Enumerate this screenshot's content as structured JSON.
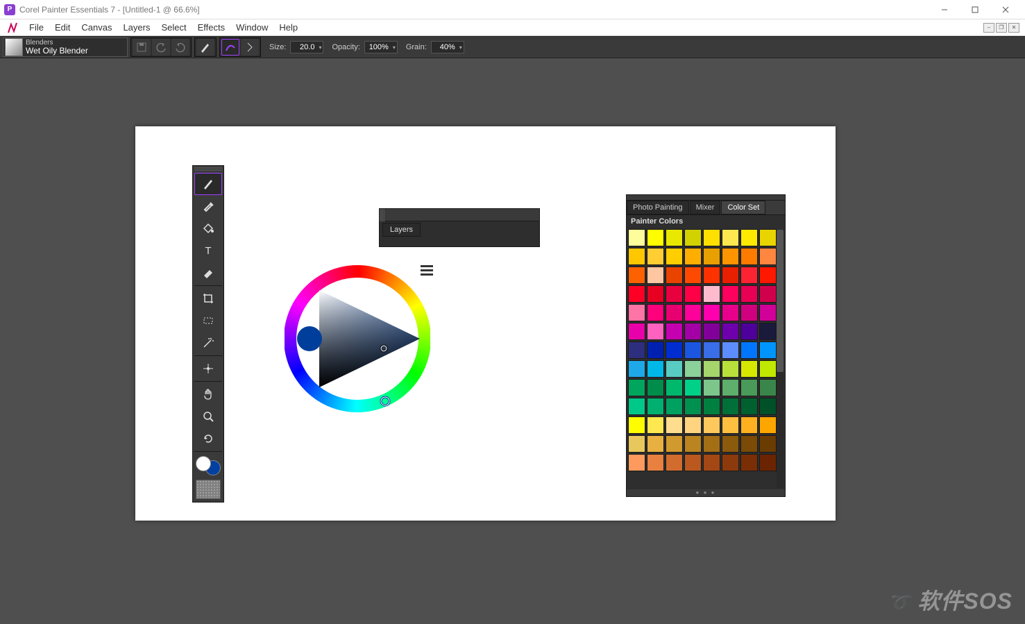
{
  "titlebar": {
    "title": "Corel Painter Essentials 7 - [Untitled-1 @ 66.6%]"
  },
  "menu": {
    "items": [
      "File",
      "Edit",
      "Canvas",
      "Layers",
      "Select",
      "Effects",
      "Window",
      "Help"
    ]
  },
  "propbar": {
    "brush_category": "Blenders",
    "brush_name": "Wet Oily Blender",
    "size_label": "Size:",
    "size_value": "20.0",
    "opacity_label": "Opacity:",
    "opacity_value": "100%",
    "grain_label": "Grain:",
    "grain_value": "40%"
  },
  "toolbox": {
    "tools": [
      {
        "name": "brush-tool",
        "icon": "brush",
        "active": true
      },
      {
        "name": "dropper-tool",
        "icon": "dropper"
      },
      {
        "name": "paint-bucket-tool",
        "icon": "bucket"
      },
      {
        "name": "text-tool",
        "icon": "text"
      },
      {
        "name": "eraser-tool",
        "icon": "eraser"
      },
      {
        "sep": true
      },
      {
        "name": "crop-tool",
        "icon": "crop"
      },
      {
        "name": "selection-tool",
        "icon": "select"
      },
      {
        "name": "magic-wand-tool",
        "icon": "wand"
      },
      {
        "sep": true
      },
      {
        "name": "transform-tool",
        "icon": "transform"
      },
      {
        "sep": true
      },
      {
        "name": "grabber-tool",
        "icon": "hand"
      },
      {
        "name": "magnifier-tool",
        "icon": "zoom"
      },
      {
        "name": "rotate-tool",
        "icon": "rotate"
      }
    ],
    "main_color": "#ffffff",
    "second_color": "#003e9c"
  },
  "layers_panel": {
    "title": "Layers"
  },
  "colorset_panel": {
    "tabs": [
      "Photo Painting",
      "Mixer",
      "Color Set"
    ],
    "active_tab": 2,
    "title": "Painter Colors",
    "swatches": [
      "#fdfd9b",
      "#fefe00",
      "#e8e800",
      "#d2d200",
      "#fee000",
      "#fee84f",
      "#fee900",
      "#e8d400",
      "#fec700",
      "#fece33",
      "#fece00",
      "#feae00",
      "#e89f00",
      "#fe9500",
      "#fe7b00",
      "#fe863e",
      "#fe6200",
      "#fec6a1",
      "#e84400",
      "#fe4a00",
      "#fe3100",
      "#e82000",
      "#fe2333",
      "#fe1800",
      "#fe0026",
      "#e80023",
      "#e8003f",
      "#fe0045",
      "#febbce",
      "#fe005d",
      "#e80055",
      "#d1004d",
      "#fe74a5",
      "#fe007c",
      "#e80071",
      "#fe009a",
      "#fe00ad",
      "#e8008d",
      "#d1007f",
      "#d10099",
      "#e800a8",
      "#fe62c0",
      "#c400b0",
      "#a300a5",
      "#82009a",
      "#6d00ac",
      "#4d009a",
      "#1a1a3c",
      "#2e2e7e",
      "#0021b0",
      "#002dd0",
      "#1a56e0",
      "#3a6de8",
      "#5d8cfe",
      "#0076fe",
      "#0095fe",
      "#1fa8e8",
      "#00b8e8",
      "#58cbc2",
      "#8ad19a",
      "#a6d56c",
      "#b8e03a",
      "#d7e800",
      "#c0e800",
      "#00a65d",
      "#008c4a",
      "#00b86c",
      "#00d188",
      "#7cc68c",
      "#5eae6c",
      "#4a9a5a",
      "#3a864a",
      "#00c888",
      "#00b070",
      "#00a060",
      "#009050",
      "#008040",
      "#007038",
      "#006030",
      "#005028",
      "#fefe00",
      "#fee84f",
      "#fede8e",
      "#fed480",
      "#fec85d",
      "#febe40",
      "#feb020",
      "#fea600",
      "#e8c85d",
      "#e8b040",
      "#d19a2e",
      "#ba8420",
      "#a36e14",
      "#8c5a0c",
      "#7a4a06",
      "#6a3c02",
      "#fe9a5d",
      "#e88040",
      "#d16c2e",
      "#ba5820",
      "#a34814",
      "#8c3a0c",
      "#7a2e06",
      "#6a2402"
    ]
  },
  "colorwheel": {
    "selected_color": "#003e9c"
  },
  "watermark": {
    "text": "软件SOS"
  }
}
